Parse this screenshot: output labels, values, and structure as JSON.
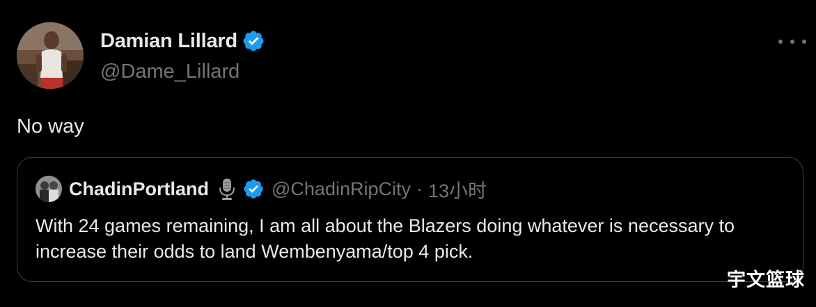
{
  "author": {
    "display_name": "Damian Lillard",
    "handle": "@Dame_Lillard",
    "verified": true,
    "avatar_icon": "profile-photo"
  },
  "tweet": {
    "text": "No way"
  },
  "quoted_tweet": {
    "display_name": "ChadinPortland",
    "handle": "@ChadinRipCity",
    "separator": "·",
    "time": "13小时",
    "badge_icon": "microphone-icon",
    "verified": true,
    "text": "With 24 games remaining, I am all about the Blazers doing whatever is necessary to increase their odds to land Wembenyama/top 4 pick."
  },
  "watermark": "宇文篮球",
  "colors": {
    "background": "#000000",
    "primary_text": "#e7e9ea",
    "secondary_text": "#71767b",
    "verified_blue": "#1d9bf0",
    "border": "#3e4144"
  }
}
